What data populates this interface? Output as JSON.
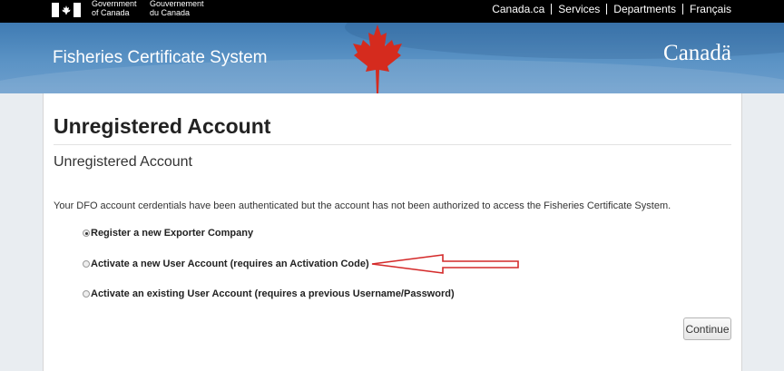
{
  "header": {
    "gov_en_line1": "Government",
    "gov_en_line2": "of Canada",
    "gov_fr_line1": "Gouvernement",
    "gov_fr_line2": "du Canada",
    "links": [
      "Canada.ca",
      "Services",
      "Departments",
      "Français"
    ]
  },
  "banner": {
    "site_title": "Fisheries Certificate System",
    "wordmark": "Canadä"
  },
  "main": {
    "page_title": "Unregistered Account",
    "subtitle": "Unregistered Account",
    "message": "Your DFO account cerdentials have been authenticated but the account has not been authorized to access the Fisheries Certificate System.",
    "options": [
      {
        "label": "Register a new Exporter Company",
        "selected": true
      },
      {
        "label": "Activate a new User Account (requires an Activation Code)",
        "selected": false
      },
      {
        "label": "Activate an existing User Account (requires a previous Username/Password)",
        "selected": false
      }
    ],
    "continue_label": "Continue"
  },
  "colors": {
    "top_bar": "#000000",
    "banner": "#4a86bd",
    "maple_leaf": "#d52b1e",
    "annotation_arrow": "#d42a2a"
  },
  "icons": {
    "flag": "canada-flag-icon",
    "leaf": "maple-leaf-icon",
    "annotation": "red-arrow-annotation"
  }
}
